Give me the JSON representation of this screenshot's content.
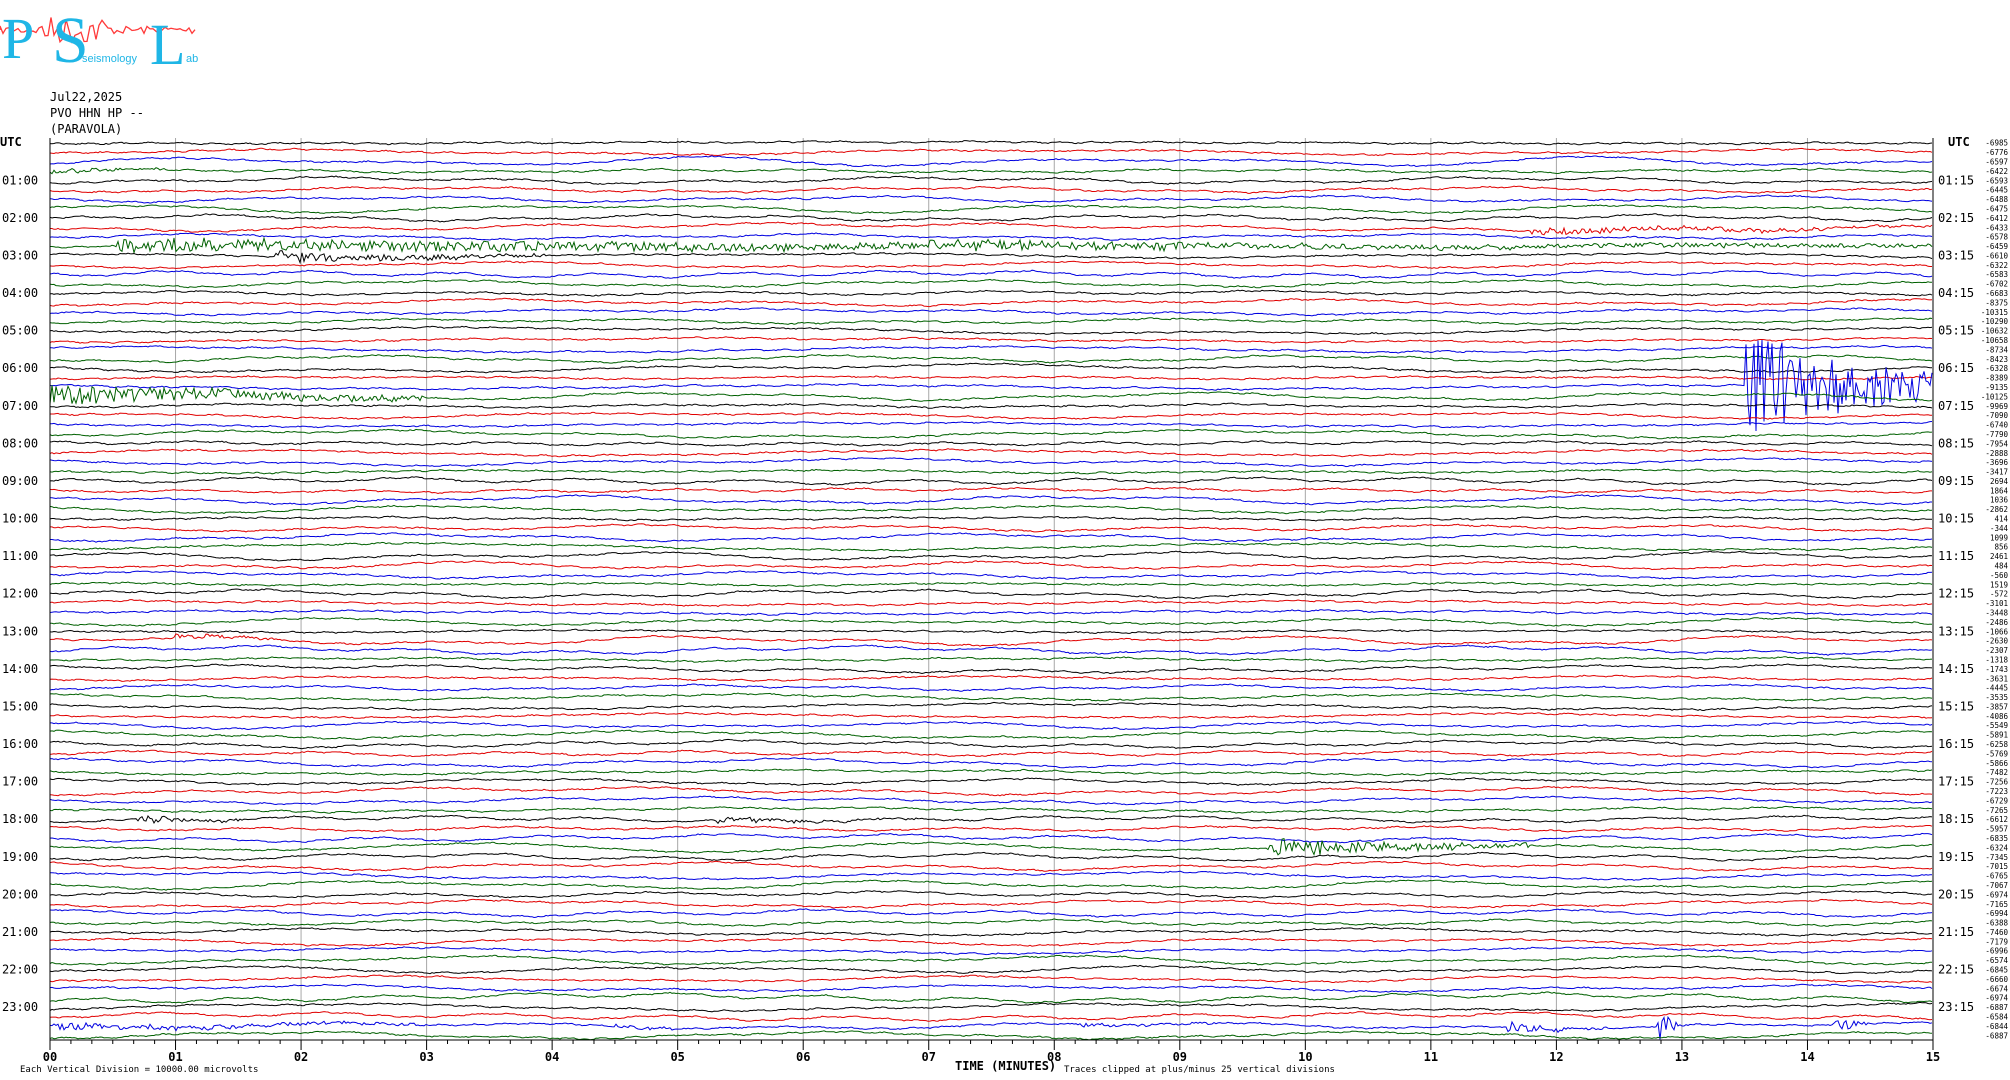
{
  "logo": {
    "letters": [
      "P",
      "S",
      "L"
    ],
    "subtitle": "seismology",
    "lab": "ab",
    "color": "#1fb6e6",
    "wave_color": "#ff3a3a"
  },
  "header": {
    "date": "Jul22,2025",
    "station": "PVO HHN HP --",
    "location": "(PARAVOLA)"
  },
  "chart_data": {
    "type": "line",
    "title": "",
    "left_label": "UTC",
    "right_label": "UTC",
    "xlabel": "TIME (MINUTES)",
    "x_ticks": [
      "00",
      "01",
      "02",
      "03",
      "04",
      "05",
      "06",
      "07",
      "08",
      "09",
      "10",
      "11",
      "12",
      "13",
      "14",
      "15"
    ],
    "xlim": [
      0,
      15
    ],
    "left_hours": [
      "01:00",
      "02:00",
      "03:00",
      "04:00",
      "05:00",
      "06:00",
      "07:00",
      "08:00",
      "09:00",
      "10:00",
      "11:00",
      "12:00",
      "13:00",
      "14:00",
      "15:00",
      "16:00",
      "17:00",
      "18:00",
      "19:00",
      "20:00",
      "21:00",
      "22:00",
      "23:00"
    ],
    "right_hours": [
      "01:15",
      "02:15",
      "03:15",
      "04:15",
      "05:15",
      "06:15",
      "07:15",
      "08:15",
      "09:15",
      "10:15",
      "11:15",
      "12:15",
      "13:15",
      "14:15",
      "15:15",
      "16:15",
      "17:15",
      "18:15",
      "19:15",
      "20:15",
      "21:15",
      "22:15",
      "23:15"
    ],
    "trace_colors": [
      "#000000",
      "#e00000",
      "#0000e0",
      "#006000"
    ],
    "traces_per_hour": 4,
    "offsets": [
      "-6985",
      "-6776",
      "-6597",
      "-6422",
      "-6593",
      "-6445",
      "-6488",
      "-6475",
      "-6412",
      "-6433",
      "-6578",
      "-6459",
      "-6610",
      "-6322",
      "-6583",
      "-6702",
      "-6683",
      "-8375",
      "-10315",
      "-10290",
      "-10632",
      "-10658",
      "-8734",
      "-8423",
      "-6328",
      "-8389",
      "-9135",
      "-10125",
      "-9969",
      "-7090",
      "-6740",
      "-7790",
      "-7954",
      "-2888",
      "-3696",
      "-3417",
      "2694",
      "1864",
      "1036",
      "-2862",
      "414",
      "-344",
      "1099",
      "856",
      "2461",
      "484",
      "-560",
      "1519",
      "-572",
      "-3101",
      "-3448",
      "-2486",
      "-1066",
      "-2630",
      "-2307",
      "-1318",
      "-1743",
      "-3631",
      "-4445",
      "-3535",
      "-3857",
      "-4086",
      "-5549",
      "-5891",
      "-6258",
      "-5769",
      "-5866",
      "-7482",
      "-7256",
      "-7223",
      "-6729",
      "-7265",
      "-6612",
      "-5957",
      "-6835",
      "-6324",
      "-7345",
      "-7015",
      "-6765",
      "-7067",
      "-6974",
      "-7165",
      "-6994",
      "-6388",
      "-7460",
      "-7179",
      "-6996",
      "-6574",
      "-6845",
      "-6660",
      "-6674",
      "-6974",
      "-6887",
      "-6584",
      "-6844",
      "-6887"
    ],
    "events": [
      {
        "trace": 3,
        "start": 0.0,
        "end": 1.0,
        "amp": 0.7
      },
      {
        "trace": 11,
        "start": 0.5,
        "end": 15.0,
        "amp": 1.6
      },
      {
        "trace": 12,
        "start": 1.8,
        "end": 4.0,
        "amp": 1.4
      },
      {
        "trace": 11,
        "start": 7.0,
        "end": 9.5,
        "amp": 1.3
      },
      {
        "trace": 9,
        "start": 11.8,
        "end": 15.0,
        "amp": 1.0
      },
      {
        "trace": 26,
        "start": 13.5,
        "end": 15.0,
        "amp": 14.0
      },
      {
        "trace": 27,
        "start": 0.0,
        "end": 3.0,
        "amp": 2.5
      },
      {
        "trace": 53,
        "start": 1.0,
        "end": 1.8,
        "amp": 0.8
      },
      {
        "trace": 72,
        "start": 0.7,
        "end": 1.6,
        "amp": 1.0
      },
      {
        "trace": 72,
        "start": 5.3,
        "end": 7.1,
        "amp": 0.7
      },
      {
        "trace": 75,
        "start": 9.7,
        "end": 11.8,
        "amp": 2.5
      },
      {
        "trace": 94,
        "start": 0.0,
        "end": 3.0,
        "amp": 1.0
      },
      {
        "trace": 94,
        "start": 4.5,
        "end": 5.0,
        "amp": 0.6
      },
      {
        "trace": 94,
        "start": 8.2,
        "end": 9.5,
        "amp": 0.5
      },
      {
        "trace": 94,
        "start": 11.6,
        "end": 12.4,
        "amp": 1.2
      },
      {
        "trace": 94,
        "start": 12.8,
        "end": 13.0,
        "amp": 4.0
      },
      {
        "trace": 94,
        "start": 14.2,
        "end": 14.5,
        "amp": 2.5
      }
    ],
    "footer_left": "Each Vertical Division = 10000.00 microvolts",
    "footer_right": "Traces clipped at plus/minus 25 vertical divisions"
  }
}
